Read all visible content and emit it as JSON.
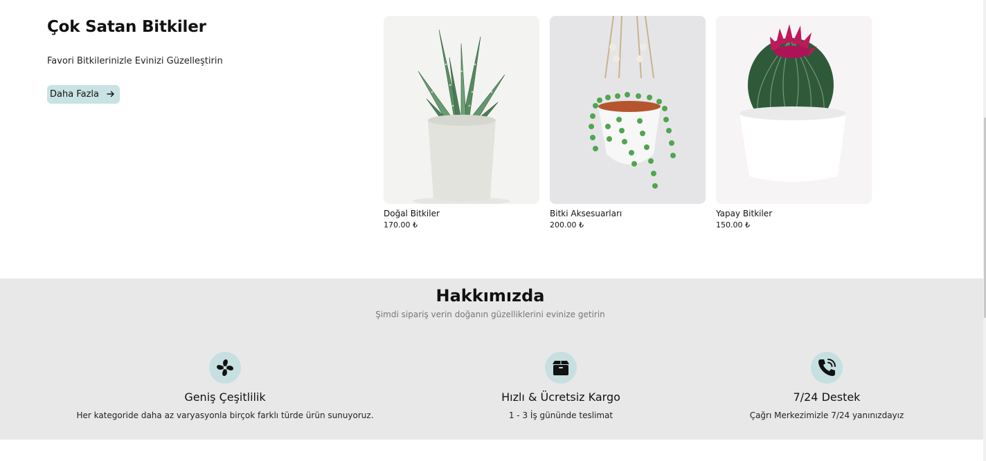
{
  "best_sellers": {
    "title": "Çok Satan Bitkiler",
    "subtitle": "Favori Bitkilerinizle Evinizi Güzelleştirin",
    "more_label": "Daha Fazla",
    "more_icon": "arrow-right-icon",
    "products": [
      {
        "name": "Doğal Bitkiler",
        "price": "170.00 ₺",
        "image": "aloe-plant-in-concrete-pot"
      },
      {
        "name": "Bitki Aksesuarları",
        "price": "200.00 ₺",
        "image": "hanging-string-of-pearls-planter"
      },
      {
        "name": "Yapay Bitkiler",
        "price": "150.00 ₺",
        "image": "flowering-cactus-in-white-pot"
      }
    ]
  },
  "about": {
    "title": "Hakkımızda",
    "subtitle": "Şimdi sipariş verin doğanın güzelliklerini evinize getirin",
    "features": [
      {
        "icon": "fan-icon",
        "title": "Geniş Çeşitlilik",
        "desc": "Her kategoride daha az varyasyonla birçok farklı türde ürün sunuyoruz."
      },
      {
        "icon": "box-icon",
        "title": "Hızlı & Ücretsiz Kargo",
        "desc": "1 - 3 İş gününde teslimat"
      },
      {
        "icon": "phone-call-icon",
        "title": "7/24 Destek",
        "desc": "Çağrı Merkezimizle 7/24 yanınızdayız"
      }
    ]
  },
  "colors": {
    "accent": "#c9e2e3",
    "section_bg": "#e8e8e8"
  }
}
